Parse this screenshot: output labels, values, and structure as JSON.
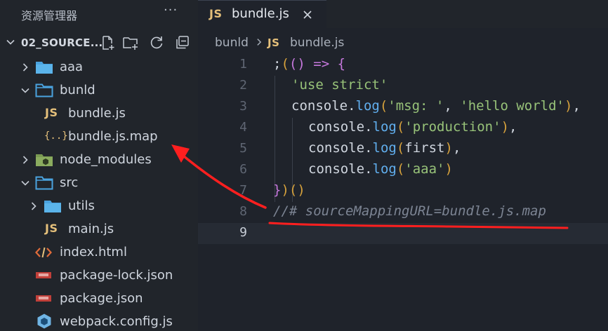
{
  "explorer": {
    "title": "资源管理器",
    "more_label": "···",
    "section_label": "02_SOURCE...",
    "tree": [
      {
        "label": "aaa",
        "kind": "folder",
        "expanded": false,
        "depth": 1
      },
      {
        "label": "bunld",
        "kind": "folder",
        "expanded": true,
        "depth": 1
      },
      {
        "label": "bundle.js",
        "kind": "js",
        "depth": 2,
        "badge": "JS"
      },
      {
        "label": "bundle.js.map",
        "kind": "map",
        "depth": 2,
        "badge": "{..}"
      },
      {
        "label": "node_modules",
        "kind": "node-folder",
        "expanded": false,
        "depth": 1
      },
      {
        "label": "src",
        "kind": "folder",
        "expanded": true,
        "depth": 1
      },
      {
        "label": "utils",
        "kind": "folder",
        "expanded": false,
        "depth": 2
      },
      {
        "label": "main.js",
        "kind": "js",
        "depth": 2,
        "badge": "JS"
      },
      {
        "label": "index.html",
        "kind": "html",
        "depth": 1
      },
      {
        "label": "package-lock.json",
        "kind": "npm",
        "depth": 1
      },
      {
        "label": "package.json",
        "kind": "npm",
        "depth": 1
      },
      {
        "label": "webpack.config.js",
        "kind": "webpack",
        "depth": 1
      }
    ]
  },
  "tab": {
    "badge": "JS",
    "label": "bundle.js"
  },
  "breadcrumb": {
    "folder": "bunld",
    "badge": "JS",
    "file": "bundle.js"
  },
  "code": {
    "line_numbers": [
      "1",
      "2",
      "3",
      "4",
      "5",
      "6",
      "7",
      "8",
      "9"
    ],
    "lines": {
      "l1": {
        "semi": ";",
        "p1": "(",
        "p2": "(",
        "p3": ")",
        "arrow": " => ",
        "brace": "{"
      },
      "l2": {
        "str": "'use strict'"
      },
      "l3": {
        "obj": "console.",
        "fn": "log",
        "open": "(",
        "s1": "'msg: '",
        "comma": ", ",
        "s2": "'hello world'",
        "close": ")",
        "end": ","
      },
      "l4": {
        "obj": "console.",
        "fn": "log",
        "open": "(",
        "s1": "'production'",
        "close": ")",
        "end": ","
      },
      "l5": {
        "obj": "console.",
        "fn": "log",
        "open": "(",
        "arg": "first",
        "close": ")",
        "end": ","
      },
      "l6": {
        "obj": "console.",
        "fn": "log",
        "open": "(",
        "s1": "'aaa'",
        "close": ")"
      },
      "l7": {
        "brace": "}",
        "p1": ")",
        "p2": "(",
        "p3": ")"
      },
      "l8": {
        "comment": "//# sourceMappingURL=bundle.js.map"
      }
    }
  },
  "colors": {
    "background": "#1f232b",
    "sidebar": "#21252b",
    "string": "#98c379",
    "function": "#61afef",
    "keyword": "#c678dd",
    "bracket": "#d7a23c",
    "comment": "#7c8493",
    "annotation": "#ff1f1f"
  }
}
